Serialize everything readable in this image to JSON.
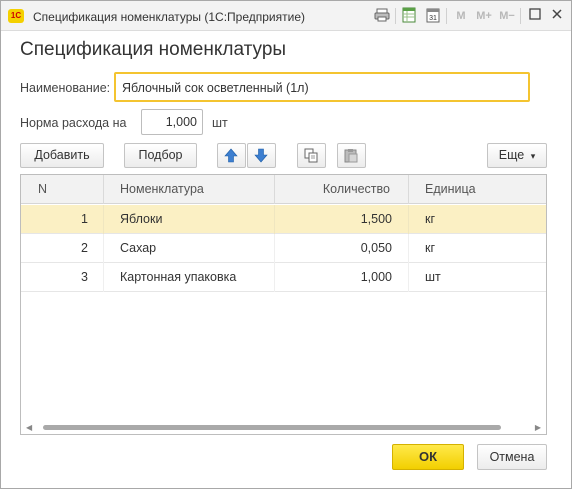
{
  "window": {
    "app_logo": "1С",
    "title": "Спецификация номенклатуры  (1С:Предприятие)",
    "toolbar_m": [
      "M",
      "M+",
      "M−"
    ]
  },
  "form": {
    "title": "Спецификация номенклатуры",
    "name_label": "Наименование:",
    "name_value": "Яблочный сок осветленный (1л)",
    "rate_label": "Норма расхода на",
    "rate_value": "1,000",
    "rate_unit": "шт"
  },
  "commandbar": {
    "add_label": "Добавить",
    "pick_label": "Подбор",
    "more_label": "Еще",
    "more_arrow": "▾"
  },
  "table": {
    "columns": [
      "N",
      "Номенклатура",
      "Количество",
      "Единица"
    ],
    "rows": [
      {
        "n": "1",
        "item": "Яблоки",
        "qty": "1,500",
        "unit": "кг"
      },
      {
        "n": "2",
        "item": "Сахар",
        "qty": "0,050",
        "unit": "кг"
      },
      {
        "n": "3",
        "item": "Картонная упаковка",
        "qty": "1,000",
        "unit": "шт"
      }
    ],
    "selected_row": 0
  },
  "footer": {
    "ok_label": "ОК",
    "cancel_label": "Отмена"
  },
  "colors": {
    "accent": "#f4c430",
    "selected_row": "#fbf0c4",
    "ok_button": "#f2cf00",
    "arrow_blue": "#3d7fd0"
  }
}
